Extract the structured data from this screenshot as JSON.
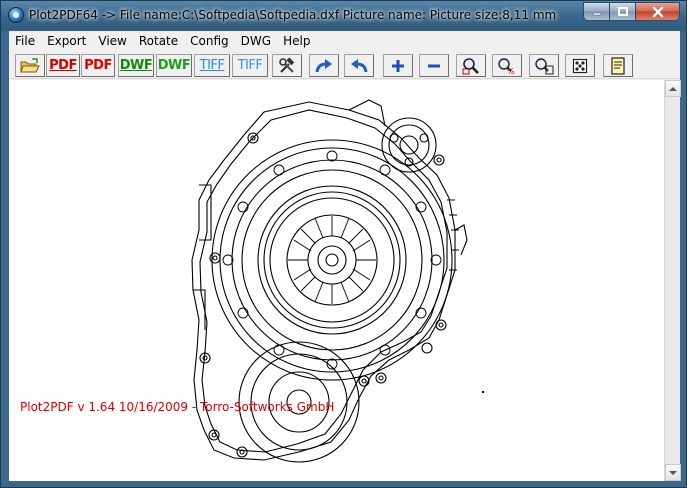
{
  "window": {
    "title": "Plot2PDF64  -> File name:C:\\Softpedia\\Softpedia.dxf Picture name: Picture size:8,11 mm"
  },
  "menu": [
    "File",
    "Export",
    "View",
    "Rotate",
    "Config",
    "DWG",
    "Help"
  ],
  "toolbar": {
    "pdf_label": "PDF",
    "pdf2_label": "PDF",
    "dwf_label": "DWF",
    "dwf2_label": "DWF",
    "tiff_label": "TIFF",
    "tiff2_label": "TIFF",
    "colors": {
      "pdf": "#d40000",
      "dwf": "#138a0d",
      "tiff": "#2e8ae6"
    }
  },
  "canvas": {
    "version_text": "Plot2PDF v 1.64 10/16/2009 - Torro-Softworks GmbH"
  }
}
